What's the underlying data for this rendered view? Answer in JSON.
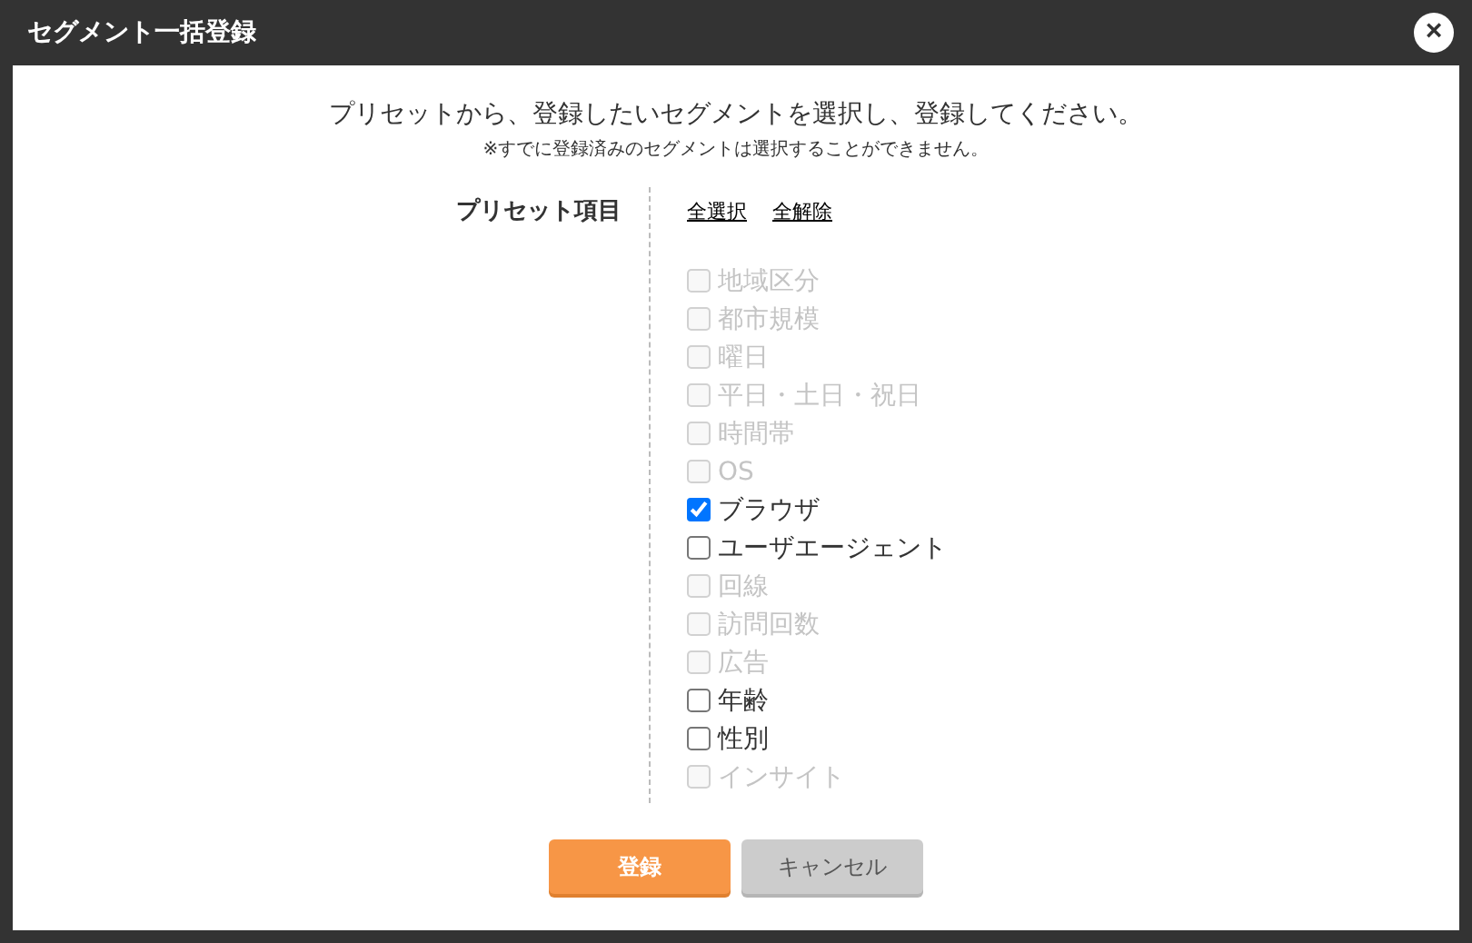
{
  "window": {
    "title": "セグメント一括登録",
    "close": "×"
  },
  "intro": "プリセットから、登録したいセグメントを選択し、登録してください。",
  "note": "※すでに登録済みのセグメントは選択することができません。",
  "preset": {
    "label": "プリセット項目",
    "links": [
      "全選択",
      "全解除"
    ],
    "items": [
      {
        "label": "地域区分",
        "checked": false,
        "disabled": true
      },
      {
        "label": "都市規模",
        "checked": false,
        "disabled": true
      },
      {
        "label": "曜日",
        "checked": false,
        "disabled": true
      },
      {
        "label": "平日・土日・祝日",
        "checked": false,
        "disabled": true
      },
      {
        "label": "時間帯",
        "checked": false,
        "disabled": true
      },
      {
        "label": "OS",
        "checked": false,
        "disabled": true
      },
      {
        "label": "ブラウザ",
        "checked": true,
        "disabled": false
      },
      {
        "label": "ユーザエージェント",
        "checked": false,
        "disabled": false
      },
      {
        "label": "回線",
        "checked": false,
        "disabled": true
      },
      {
        "label": "訪問回数",
        "checked": false,
        "disabled": true
      },
      {
        "label": "広告",
        "checked": false,
        "disabled": true
      },
      {
        "label": "年齢",
        "checked": false,
        "disabled": false
      },
      {
        "label": "性別",
        "checked": false,
        "disabled": false
      },
      {
        "label": "インサイト",
        "checked": false,
        "disabled": true
      }
    ]
  },
  "buttons": [
    {
      "label": "登録",
      "kind": "primary"
    },
    {
      "label": "キャンセル",
      "kind": "secondary"
    }
  ]
}
